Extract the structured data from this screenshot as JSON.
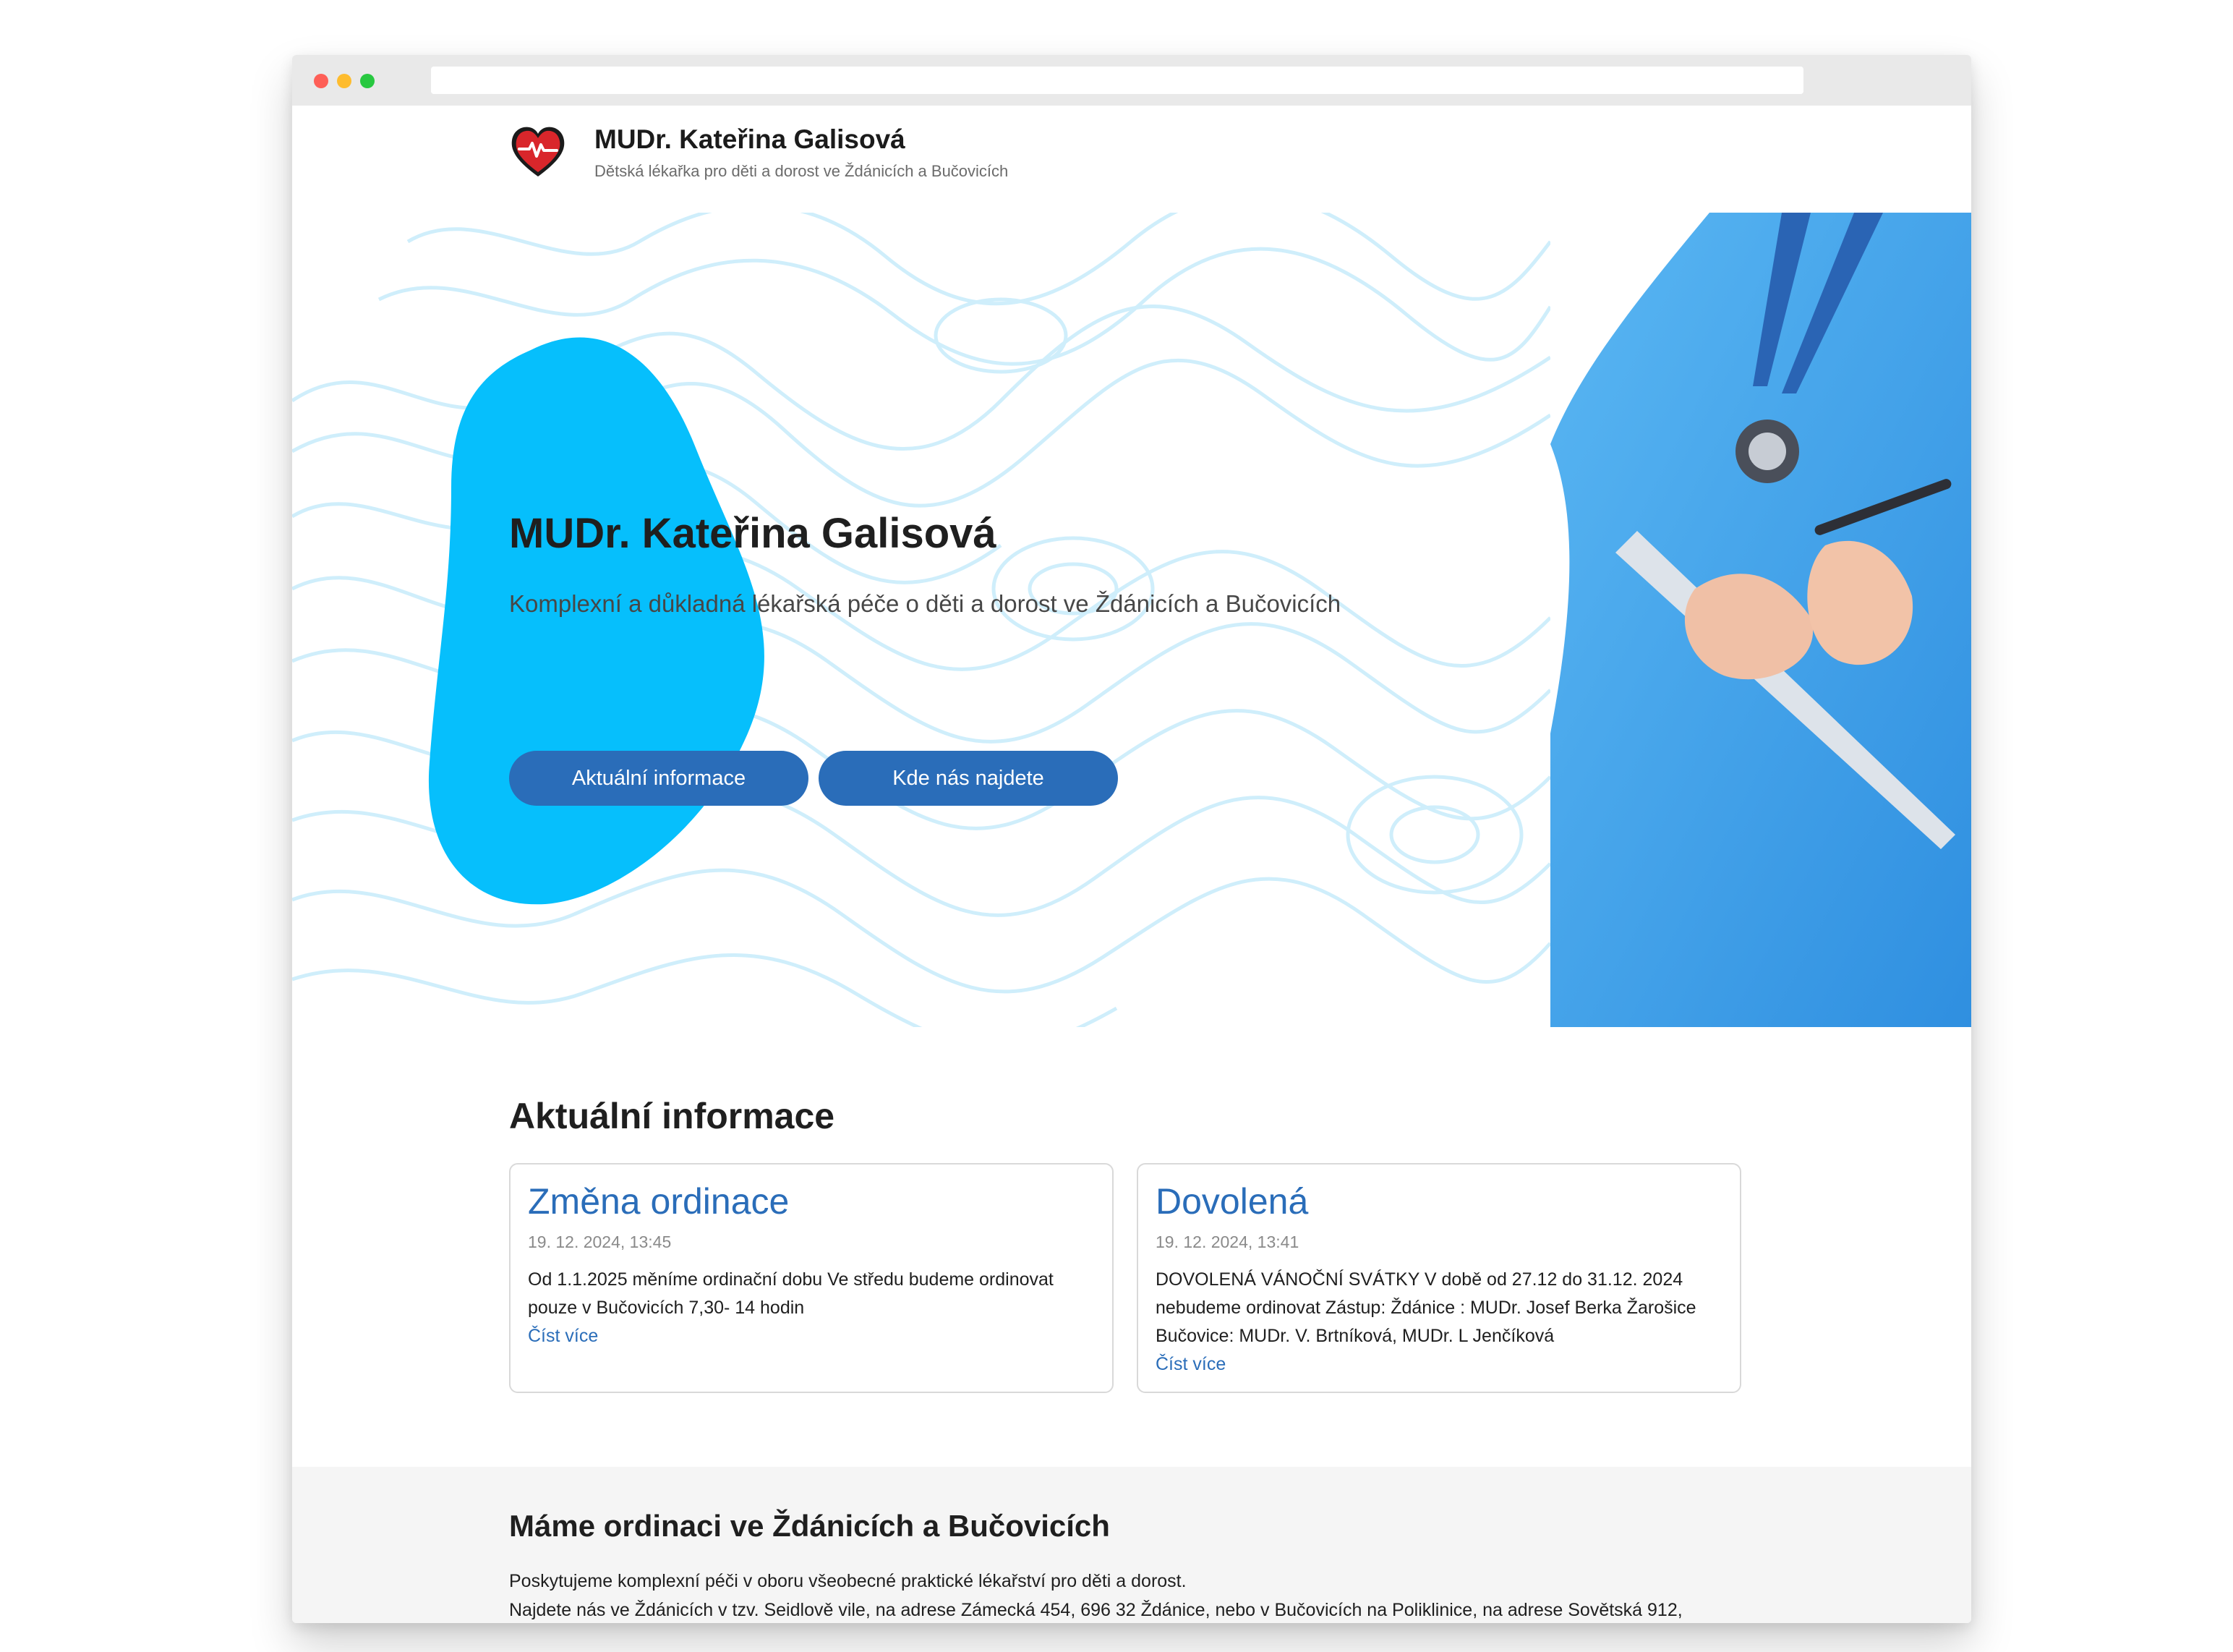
{
  "header": {
    "title": "MUDr. Kateřina Galisová",
    "subtitle": "Dětská lékařka pro děti a dorost ve Ždánicích a Bučovicích"
  },
  "hero": {
    "title": "MUDr. Kateřina Galisová",
    "subtitle": "Komplexní a důkladná lékařská péče o děti a dorost ve Ždánicích a Bučovicích",
    "buttons": [
      {
        "label": "Aktuální informace"
      },
      {
        "label": "Kde nás najdete"
      }
    ]
  },
  "news": {
    "heading": "Aktuální informace",
    "items": [
      {
        "title": "Změna ordinace",
        "date": "19. 12. 2024, 13:45",
        "text": "Od 1.1.2025 měníme ordinační dobu Ve středu budeme ordinovat pouze v Bučovicích 7,30- 14 hodin",
        "link": "Číst více"
      },
      {
        "title": "Dovolená",
        "date": "19. 12. 2024, 13:41",
        "text": "DOVOLENÁ VÁNOČNÍ SVÁTKY V době od 27.12 do 31.12. 2024 nebudeme ordinovat Zástup: Ždánice : MUDr. Josef Berka Žarošice Bučovice: MUDr. V. Brtníková, MUDr. L Jenčíková",
        "link": "Číst více"
      }
    ]
  },
  "location": {
    "heading": "Máme ordinaci ve Ždánicích a Bučovicích",
    "line1": "Poskytujeme komplexní péči v oboru všeobecné praktické lékařství pro děti a dorost.",
    "line2": "Najdete nás ve Ždánicích v tzv. Seidlově vile, na adrese Zámecká 454, 696 32 Ždánice, nebo v Bučovicích na Poliklinice, na adrese Sovětská 912,"
  },
  "colors": {
    "accent": "#2a6db9",
    "blob": "#06bffc",
    "heart": "#d9262b",
    "scrubs": "#3ea0ea"
  },
  "icons": {
    "logo": "heart-pulse-icon"
  }
}
